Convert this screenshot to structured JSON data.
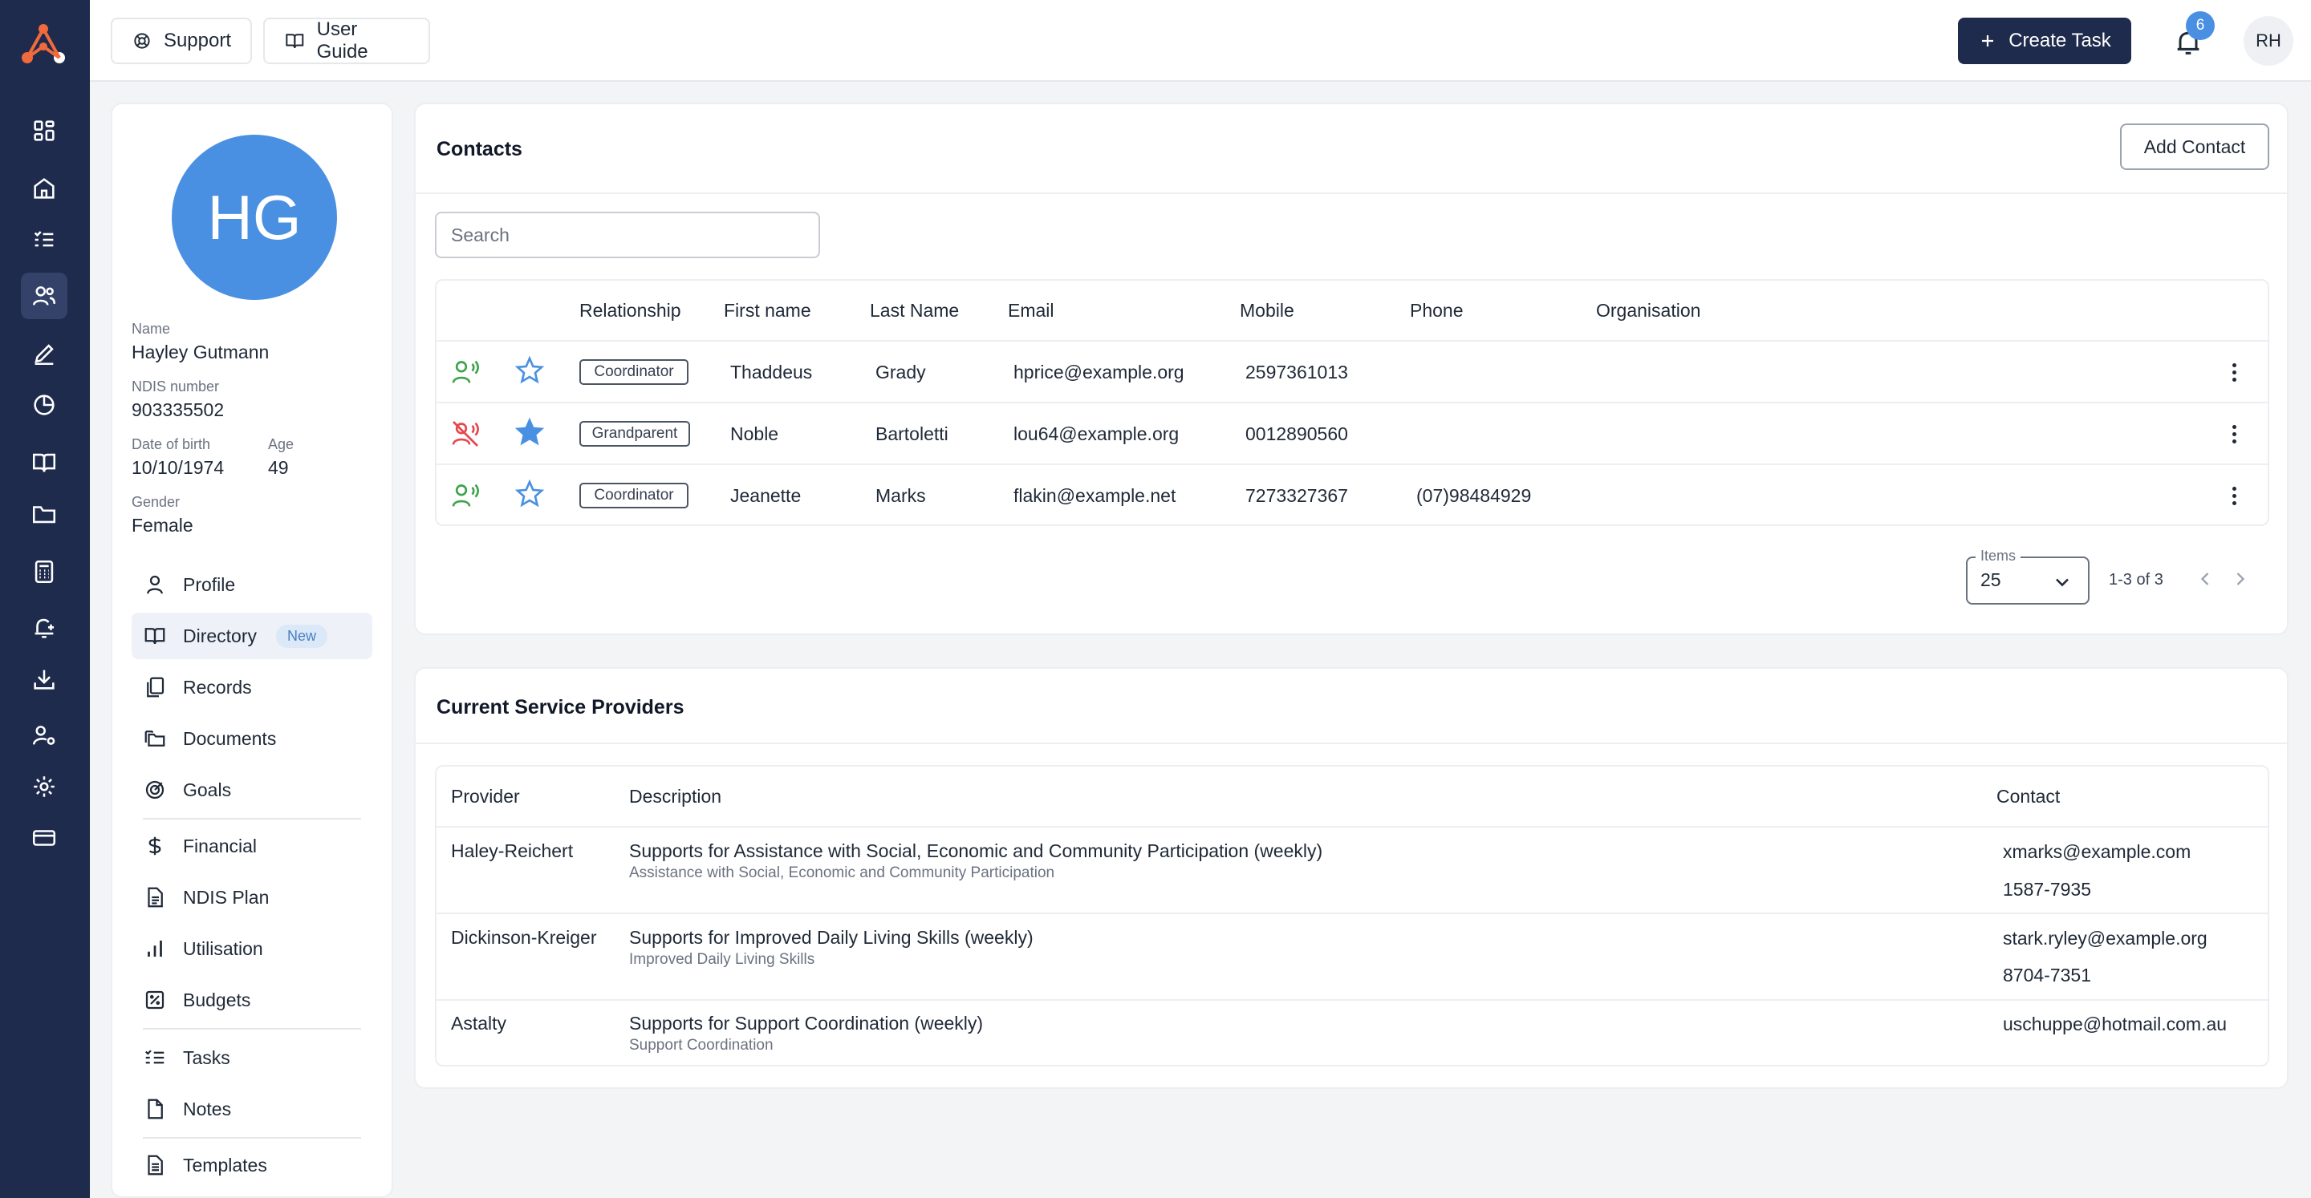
{
  "topbar": {
    "support_label": "Support",
    "guide_label": "User Guide",
    "create_task_label": "Create Task",
    "notification_count": "6",
    "user_initials": "RH"
  },
  "profile": {
    "initials": "HG",
    "name_label": "Name",
    "name": "Hayley Gutmann",
    "ndis_label": "NDIS number",
    "ndis": "903335502",
    "dob_label": "Date of birth",
    "dob": "10/10/1974",
    "age_label": "Age",
    "age": "49",
    "gender_label": "Gender",
    "gender": "Female"
  },
  "menu": {
    "profile": "Profile",
    "directory": "Directory",
    "directory_badge": "New",
    "records": "Records",
    "documents": "Documents",
    "goals": "Goals",
    "financial": "Financial",
    "ndis_plan": "NDIS Plan",
    "utilisation": "Utilisation",
    "budgets": "Budgets",
    "tasks": "Tasks",
    "notes": "Notes",
    "templates": "Templates"
  },
  "contacts": {
    "title": "Contacts",
    "add_label": "Add Contact",
    "search_placeholder": "Search",
    "headers": {
      "relationship": "Relationship",
      "first_name": "First name",
      "last_name": "Last Name",
      "email": "Email",
      "mobile": "Mobile",
      "phone": "Phone",
      "organisation": "Organisation"
    },
    "rows": [
      {
        "relationship": "Coordinator",
        "first": "Thaddeus",
        "last": "Grady",
        "email": "hprice@example.org",
        "mobile": "2597361013",
        "phone": "",
        "organisation": ""
      },
      {
        "relationship": "Grandparent",
        "first": "Noble",
        "last": "Bartoletti",
        "email": "lou64@example.org",
        "mobile": "0012890560",
        "phone": "",
        "organisation": ""
      },
      {
        "relationship": "Coordinator",
        "first": "Jeanette",
        "last": "Marks",
        "email": "flakin@example.net",
        "mobile": "7273327367",
        "phone": "(07)98484929",
        "organisation": ""
      }
    ],
    "items_label": "Items",
    "items_value": "25",
    "range_text": "1-3 of 3"
  },
  "providers": {
    "title": "Current Service Providers",
    "headers": {
      "provider": "Provider",
      "description": "Description",
      "contact": "Contact"
    },
    "rows": [
      {
        "provider": "Haley-Reichert",
        "description": "Supports for Assistance with Social, Economic and Community Participation (weekly)",
        "sub": "Assistance with Social, Economic and Community Participation",
        "email": "xmarks@example.com",
        "phone": "1587-7935"
      },
      {
        "provider": "Dickinson-Kreiger",
        "description": "Supports for Improved Daily Living Skills (weekly)",
        "sub": "Improved Daily Living Skills",
        "email": "stark.ryley@example.org",
        "phone": "8704-7351"
      },
      {
        "provider": "Astalty",
        "description": "Supports for Support Coordination (weekly)",
        "sub": "Support Coordination",
        "email": "uschuppe@hotmail.com.au",
        "phone": ""
      }
    ]
  },
  "colors": {
    "nav_bg": "#1f2b4d",
    "accent_blue": "#4a90e2",
    "phone_green": "#3fa34d",
    "phone_red": "#e5484d"
  }
}
